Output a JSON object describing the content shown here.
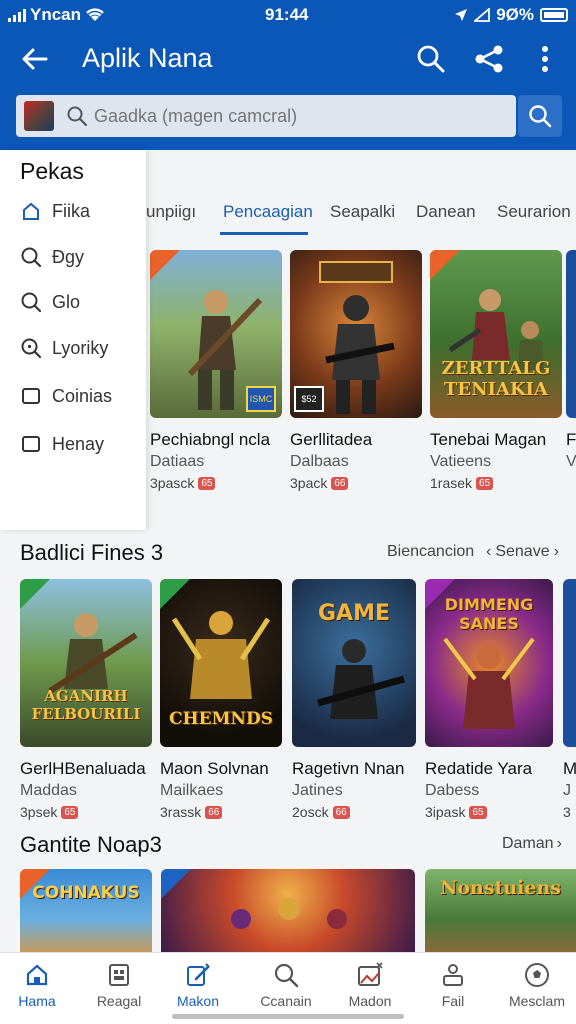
{
  "status_bar": {
    "carrier": "Yncan",
    "time": "91:44",
    "battery": "9Ø%"
  },
  "app_bar": {
    "title": "Aplik Nana"
  },
  "search": {
    "placeholder": "Gaadka (magen camcral)"
  },
  "drawer": {
    "title": "Pekas",
    "items": [
      {
        "label": "Fiika",
        "icon": "home-outline-icon"
      },
      {
        "label": "Ðgy",
        "icon": "search-icon"
      },
      {
        "label": "Glo",
        "icon": "search-icon"
      },
      {
        "label": "Lyoriky",
        "icon": "search-plus-icon"
      },
      {
        "label": "Coinias",
        "icon": "square-icon"
      },
      {
        "label": "Henay",
        "icon": "square-icon"
      }
    ]
  },
  "tabs": [
    {
      "label": "unpiigı",
      "active": false
    },
    {
      "label": "Pencaagian",
      "active": true
    },
    {
      "label": "Seapalki",
      "active": false
    },
    {
      "label": "Danean",
      "active": false
    },
    {
      "label": "Seurarion",
      "active": false
    }
  ],
  "row1": [
    {
      "name": "Pechiabngl ncla",
      "dev": "Datiaas",
      "size": "3pasck",
      "badge": "65",
      "tag": "ISMC"
    },
    {
      "name": "Gerllitadea",
      "dev": "Dalbaas",
      "size": "3pack",
      "badge": "66",
      "tag": "$52"
    },
    {
      "name": "Tenebai Magan",
      "dev": "Vatieens",
      "size": "1rasek",
      "badge": "65",
      "art_text": "ZERTTALG TENIAKIA"
    },
    {
      "name": "F",
      "dev": "V",
      "size": "",
      "badge": ""
    }
  ],
  "section2": {
    "title": "Badlici Fines 3",
    "link1": "Biencancion",
    "link2": "Senave"
  },
  "row2": [
    {
      "name": "GerlHBenaluada",
      "dev": "Maddas",
      "size": "3psek",
      "badge": "65",
      "art_text": "AGANIRH FELBOURILI"
    },
    {
      "name": "Maon Solvnan",
      "dev": "Mailkaes",
      "size": "3rassk",
      "badge": "66",
      "art_text": "CHEMNDS"
    },
    {
      "name": "Ragetivn Nnan",
      "dev": "Jatines",
      "size": "2osck",
      "badge": "66",
      "art_top": "GAME"
    },
    {
      "name": "Redatide Yara",
      "dev": "Dabess",
      "size": "3ipask",
      "badge": "65",
      "art_top": "DIMMENG SANES"
    },
    {
      "name": "M",
      "dev": "J",
      "size": "3",
      "badge": ""
    }
  ],
  "section3": {
    "title": "Gantite Noap3",
    "link": "Daman"
  },
  "row3": [
    {
      "art_top": "COHNAKUS"
    },
    {
      "art_top": ""
    },
    {
      "art_top": "Nonstuiens"
    }
  ],
  "bottom_nav": [
    {
      "label": "Hama",
      "icon": "home-icon",
      "active": true
    },
    {
      "label": "Reagal",
      "icon": "grid-icon",
      "active": false
    },
    {
      "label": "Makon",
      "icon": "edit-icon",
      "active": true
    },
    {
      "label": "Ccanain",
      "icon": "search-icon",
      "active": false
    },
    {
      "label": "Madon",
      "icon": "image-icon",
      "active": false
    },
    {
      "label": "Fail",
      "icon": "person-icon",
      "active": false
    },
    {
      "label": "Mesclam",
      "icon": "soccer-icon",
      "active": false
    }
  ],
  "colors": {
    "primary": "#0b57b8",
    "accent": "#1a5fb4",
    "badge": "#d9534f"
  }
}
